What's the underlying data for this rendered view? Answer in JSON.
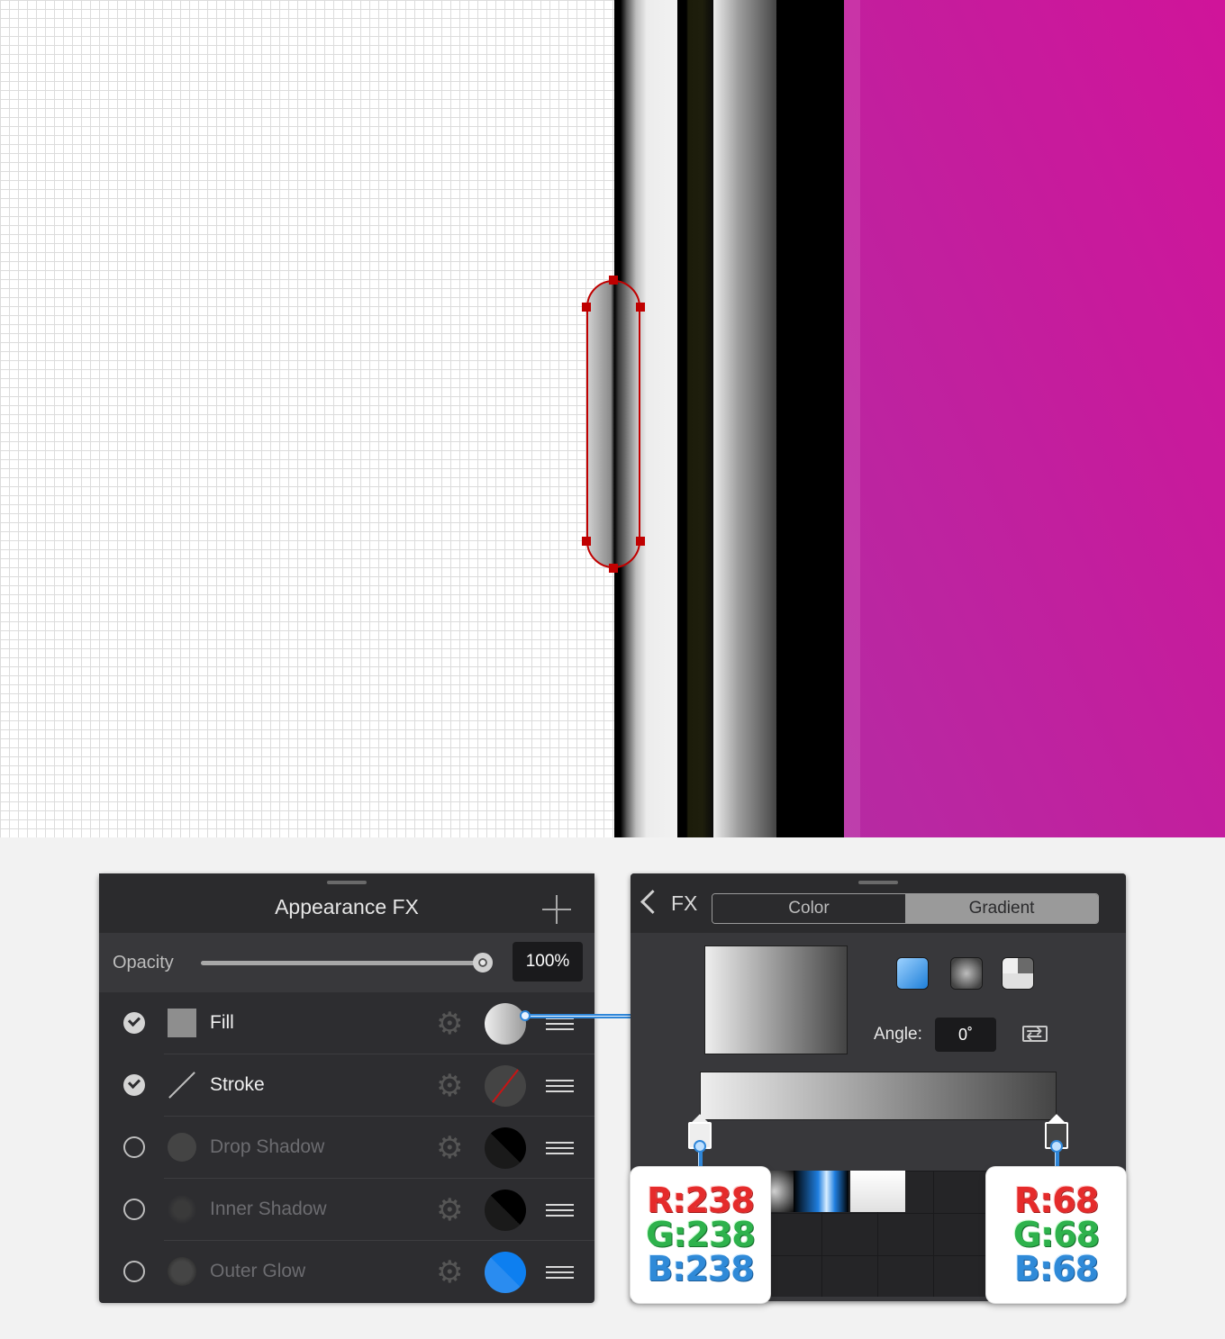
{
  "appearance_panel": {
    "title": "Appearance FX",
    "add_icon": "plus-icon",
    "opacity": {
      "label": "Opacity",
      "value": "100%",
      "level": 1.0
    },
    "effects": [
      {
        "name": "Fill",
        "enabled": true,
        "swatch": "gradient-light-to-dark"
      },
      {
        "name": "Stroke",
        "enabled": true,
        "swatch": "none"
      },
      {
        "name": "Drop Shadow",
        "enabled": false,
        "swatch": "#000000"
      },
      {
        "name": "Inner Shadow",
        "enabled": false,
        "swatch": "#000000"
      },
      {
        "name": "Outer Glow",
        "enabled": false,
        "swatch": "#1a85f0"
      }
    ],
    "icons": {
      "settings": "gear-icon",
      "reorder": "drag-handle-icon",
      "check": "checkmark-icon"
    }
  },
  "gradient_panel": {
    "back_label": "FX",
    "tabs": {
      "color": "Color",
      "gradient": "Gradient",
      "active": "Gradient"
    },
    "angle": {
      "label": "Angle:",
      "value": "0˚"
    },
    "gradient_types": [
      "linear-gradient-icon",
      "radial-gradient-icon",
      "conical-gradient-icon"
    ],
    "swap_icon": "swap-icon",
    "stops": [
      {
        "position": 0,
        "color": "#eeeeee"
      },
      {
        "position": 1,
        "color": "#444444"
      }
    ]
  },
  "callouts": {
    "left": {
      "r": "R:238",
      "g": "G:238",
      "b": "B:238"
    },
    "right": {
      "r": "R:68",
      "g": "G:68",
      "b": "B:68"
    }
  },
  "colors": {
    "accent_blue": "#2f86d8",
    "selection_red": "#c00000",
    "magenta": "#c41d9d"
  }
}
